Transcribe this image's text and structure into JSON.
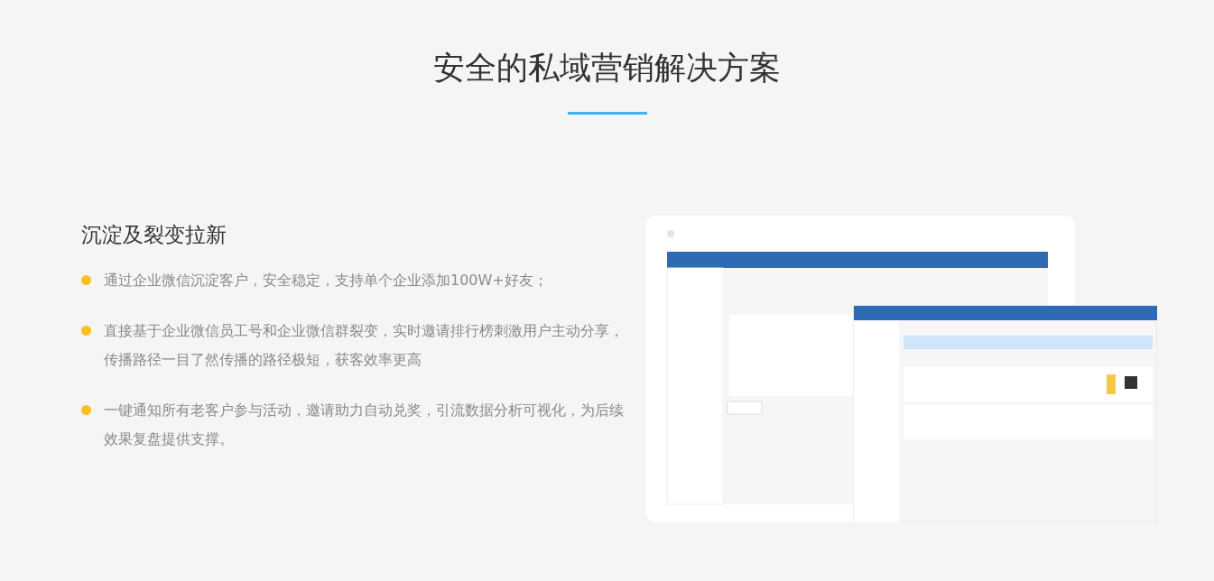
{
  "title": "安全的私域营销解决方案",
  "section": {
    "heading": "沉淀及裂变拉新",
    "points": [
      "通过企业微信沉淀客户，安全稳定，支持单个企业添加100W+好友；",
      "直接基于企业微信员工号和企业微信群裂变，实时邀请排行榜刺激用户主动分享，传播路径一目了然传播的路径极短，获客效率更高",
      "一键通知所有老客户参与活动，邀请助力自动兑奖，引流数据分析可视化，为后续效果复盘提供支撑。"
    ]
  }
}
